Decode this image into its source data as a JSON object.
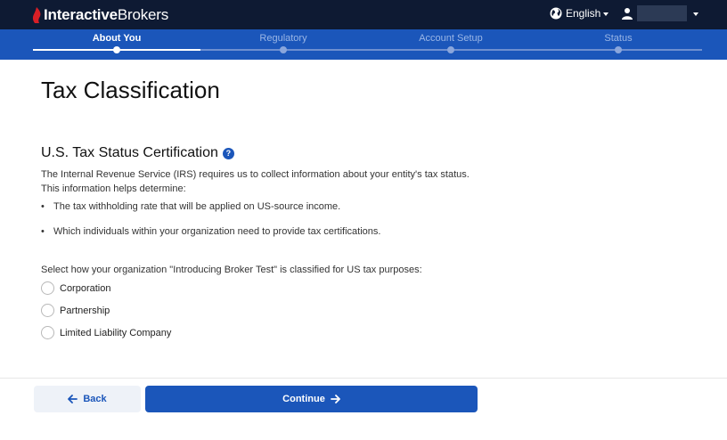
{
  "header": {
    "brand_bold": "Interactive",
    "brand_regular": "Brokers",
    "language": "English",
    "icons": [
      "flame-logo-icon",
      "globe-icon",
      "user-icon",
      "chevron-down-icon"
    ]
  },
  "stepper": {
    "steps": [
      {
        "label": "About You",
        "active": true
      },
      {
        "label": "Regulatory",
        "active": false
      },
      {
        "label": "Account Setup",
        "active": false
      },
      {
        "label": "Status",
        "active": false
      }
    ]
  },
  "main": {
    "page_title": "Tax Classification",
    "section_title": "U.S. Tax Status Certification",
    "help_glyph": "?",
    "intro": "The Internal Revenue Service (IRS) requires us to collect information about your entity's tax status. This information helps determine:",
    "bullets": [
      "The tax withholding rate that will be applied on US-source income.",
      "Which individuals within your organization need to provide tax certifications."
    ],
    "prompt": "Select how your organization \"Introducing Broker Test\" is classified for US tax purposes:",
    "options": [
      "Corporation",
      "Partnership",
      "Limited Liability Company"
    ],
    "selected_option": null
  },
  "footer": {
    "back_label": "Back",
    "continue_label": "Continue"
  },
  "colors": {
    "topbar": "#0e1a33",
    "accent": "#1b56ba",
    "logo_red": "#d81f26"
  }
}
